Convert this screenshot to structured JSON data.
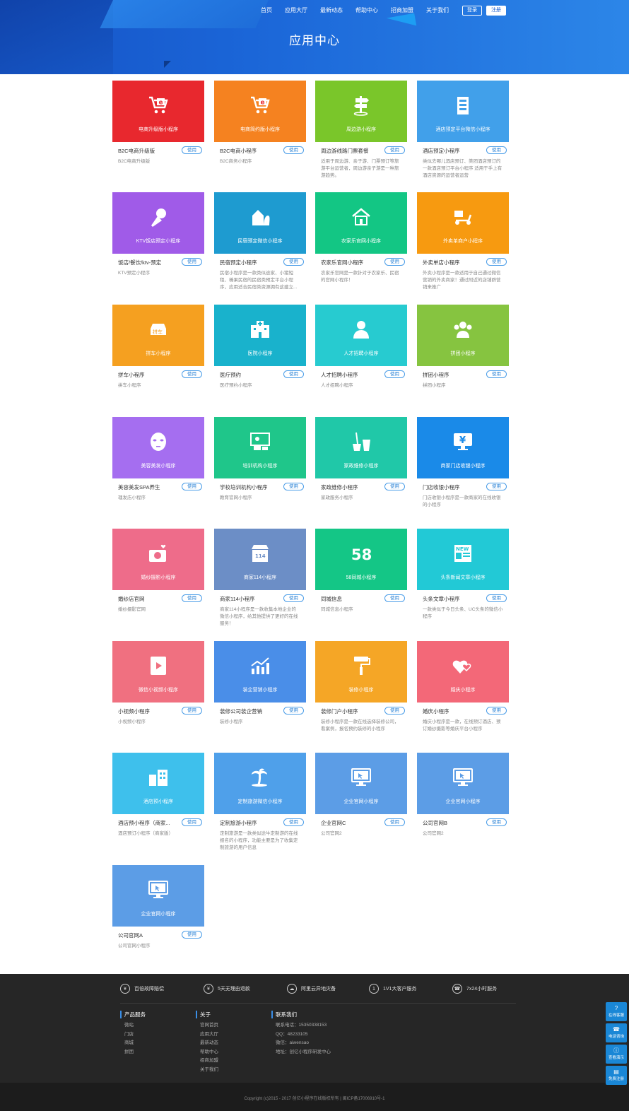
{
  "nav": {
    "items": [
      "首页",
      "应用大厅",
      "最新动态",
      "帮助中心",
      "招商加盟",
      "关于我们"
    ],
    "login": "登录",
    "register": "注册"
  },
  "page_title": "应用中心",
  "use_label": "使用",
  "apps": [
    {
      "caption": "电商升级版小程序",
      "name": "B2C电商升级版",
      "desc": "B2C电商升级版",
      "color": "#e8282e",
      "icon": "cart-e-icon"
    },
    {
      "caption": "电商简约版小程序",
      "name": "B2C电商小程序",
      "desc": "B2C商务小程序",
      "color": "#f58220",
      "icon": "cart-e-icon"
    },
    {
      "caption": "周边游小程序",
      "name": "周边游线路门票套餐",
      "desc": "适用于周边游、亲子游、门票预订等旅游平台运营者，周边游亲子游是一种旅游趋势。",
      "color": "#7ac62a",
      "icon": "signpost-icon"
    },
    {
      "caption": "酒店预定平台微信小程序",
      "name": "酒店预定小程序",
      "desc": "类似去哪儿酒店预订、美团酒店预订的一款酒店预订平台小程序 适用于手上有酒店资源的运营者运营",
      "color": "#41a0ea",
      "icon": "building-icon"
    },
    {
      "caption": "KTV饭店预定小程序",
      "name": "饭店/餐饮/ktv-预定",
      "desc": "KTV预定小程序",
      "color": "#a05be8",
      "icon": "microphone-icon"
    },
    {
      "caption": "民宿预定微信小程序",
      "name": "民宿预定小程序",
      "desc": "民宿小程序是一款类似途家、小猪短租、榛果民宿的民宿类预定平台小程序，应用适合民宿类资源拥有这建立...",
      "color": "#1e9bd0",
      "icon": "house-tree-icon"
    },
    {
      "caption": "农家乐官网小程序",
      "name": "农家乐官网小程序",
      "desc": "农家乐官网是一款针对于农家乐、民宿的官网小程序！",
      "color": "#13c684",
      "icon": "farmhouse-icon"
    },
    {
      "caption": "外卖单商户小程序",
      "name": "外卖单店小程序",
      "desc": "外卖小程序是一款适用于自己通过微信营销的外卖商家！通过附近的店铺群营销来推广",
      "color": "#f79a10",
      "icon": "scooter-icon"
    },
    {
      "caption": "拼车小程序",
      "name": "拼车小程序",
      "desc": "拼车小程序",
      "color": "#f5a020",
      "icon": "carpool-icon"
    },
    {
      "caption": "医院小程序",
      "name": "医疗预约",
      "desc": "医疗预约小程序",
      "color": "#19b2cc",
      "icon": "hospital-icon"
    },
    {
      "caption": "人才招聘小程序",
      "name": "人才招聘小程序",
      "desc": "人才招聘小程序",
      "color": "#27cbd0",
      "icon": "person-icon"
    },
    {
      "caption": "拼团小程序",
      "name": "拼团小程序",
      "desc": "拼团小程序",
      "color": "#86c440",
      "icon": "group-icon"
    },
    {
      "caption": "美容美发小程序",
      "name": "美容美发SPA养生",
      "desc": "理发店小程序",
      "color": "#a56ef0",
      "icon": "face-mask-icon"
    },
    {
      "caption": "培训机构小程序",
      "name": "学校培训机构小程序",
      "desc": "教育官网小程序",
      "color": "#1fc68a",
      "icon": "teacher-board-icon"
    },
    {
      "caption": "家政维修小程序",
      "name": "家政维修小程序",
      "desc": "家政服务小程序",
      "color": "#20c8a8",
      "icon": "broom-bucket-icon"
    },
    {
      "caption": "商家门店收银小程序",
      "name": "门店收银小程序",
      "desc": "门店收银小程序是一款商家的在线收银的小程序",
      "color": "#1a8ae8",
      "icon": "yen-monitor-icon"
    },
    {
      "caption": "婚纱摄影小程序",
      "name": "婚纱店官网",
      "desc": "婚纱摄影官网",
      "color": "#ee6c8a",
      "icon": "camera-heart-icon"
    },
    {
      "caption": "商家114小程序",
      "name": "商家114小程序",
      "desc": "商家114小程序是一款收集本地企业的微信小程序，给其他提供了更好的在线服务！",
      "color": "#6c8ec6",
      "icon": "store-114-icon"
    },
    {
      "caption": "58同城小程序",
      "name": "同城信息",
      "desc": "同城信息小程序",
      "color": "#14c686",
      "icon": "number-58-icon"
    },
    {
      "caption": "头条新闻文章小程序",
      "name": "头条文章小程序",
      "desc": "一款类似于今日头条、UC头条的微信小程序",
      "color": "#22c9d6",
      "icon": "newspaper-icon"
    },
    {
      "caption": "微信小视频小程序",
      "name": "小视频小程序",
      "desc": "小视频小程序",
      "color": "#f07080",
      "icon": "video-icon"
    },
    {
      "caption": "装企营销小程序",
      "name": "装修公司装企营销",
      "desc": "装修小程序",
      "color": "#4a8ee8",
      "icon": "growth-chart-icon"
    },
    {
      "caption": "装修小程序",
      "name": "装修门户小程序",
      "desc": "装修小程序是一款在线选择装修公司，看案例，报名预约装修的小程序",
      "color": "#f5a626",
      "icon": "paint-roller-icon"
    },
    {
      "caption": "婚庆小程序",
      "name": "婚庆小程序",
      "desc": "婚庆小程序是一款，在线预订酒店、预订婚纱摄影等婚庆平台小程序",
      "color": "#f36878",
      "icon": "hearts-icon"
    },
    {
      "caption": "酒店预小程序",
      "name": "酒店预小程序（商家...",
      "desc": "酒店预订小程序（商家版）",
      "color": "#3ec0ec",
      "icon": "buildings-icon"
    },
    {
      "caption": "定制旅游微信小程序",
      "name": "定制旅游小程序",
      "desc": "定制旅游是一款类似途牛定制游的在线报名的小程序，功能主要是为了收集定制旅游的用户信息",
      "color": "#4fa0ea",
      "icon": "palm-tree-icon"
    },
    {
      "caption": "企业官网小程序",
      "name": "企业官网C",
      "desc": "公司官网2",
      "color": "#5c9de6",
      "icon": "monitor-cursor-icon"
    },
    {
      "caption": "企业官网小程序",
      "name": "公司官网B",
      "desc": "公司官网2",
      "color": "#5c9de6",
      "icon": "monitor-cursor-icon"
    },
    {
      "caption": "企业官网小程序",
      "name": "公司官网A",
      "desc": "公司官网小程序",
      "color": "#5c9de6",
      "icon": "monitor-cursor-icon"
    }
  ],
  "footer": {
    "services": [
      {
        "icon": "coin-icon",
        "label": "百倍故障赔偿"
      },
      {
        "icon": "yen-icon",
        "label": "5天无理由退款"
      },
      {
        "icon": "cloud-icon",
        "label": "阿里云异地灾备"
      },
      {
        "icon": "one-on-one-icon",
        "label": "1V1大客户服务"
      },
      {
        "icon": "phone-icon",
        "label": "7x24小时服务"
      }
    ],
    "products": {
      "title": "产品服务",
      "items": [
        "微站",
        "门店",
        "商城",
        "拼团"
      ]
    },
    "about": {
      "title": "关于",
      "items": [
        "官网首页",
        "应用大厅",
        "最新动态",
        "帮助中心",
        "招商加盟",
        "关于我们"
      ]
    },
    "contact": {
      "title": "联系我们",
      "items": [
        "联系电话：15350338153",
        "QQ：48233105",
        "微信：aiwensao",
        "地址：创亿小程序研发中心"
      ]
    },
    "copyright": "Copyright (c)2015 - 2017 创亿小程序在线版权所有 | 闽ICP备17006910号-1"
  },
  "side_buttons": [
    {
      "icon": "question-icon",
      "label": "在线客服"
    },
    {
      "icon": "phone-icon",
      "label": "电话咨询"
    },
    {
      "icon": "info-icon",
      "label": "查看演示"
    },
    {
      "icon": "doc-icon",
      "label": "免费注册"
    }
  ]
}
